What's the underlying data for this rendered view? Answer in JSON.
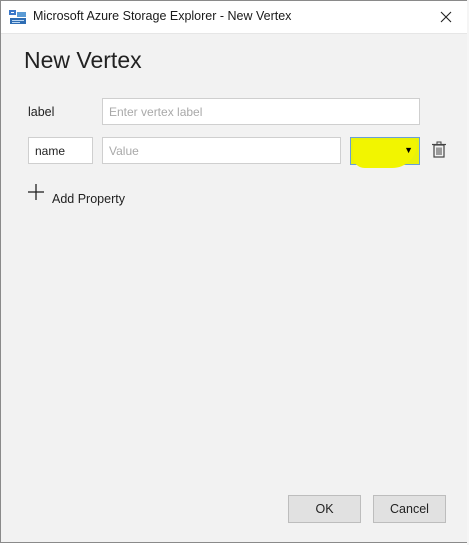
{
  "window": {
    "title": "Microsoft Azure Storage Explorer - New Vertex",
    "icon": "azure-storage-explorer-icon",
    "close_icon": "close-icon"
  },
  "dialog": {
    "heading": "New Vertex",
    "label_row": {
      "label": "label",
      "placeholder": "Enter vertex label",
      "value": ""
    },
    "property_row": {
      "name_value": "name",
      "value_placeholder": "Value",
      "value": "",
      "type_select": {
        "selected": "",
        "arrow_icon": "dropdown-arrow-icon",
        "highlight_color": "#f2f500"
      },
      "delete_icon": "trash-icon"
    },
    "add_property": {
      "label": "Add Property",
      "icon": "plus-icon"
    },
    "buttons": {
      "ok": "OK",
      "cancel": "Cancel"
    }
  }
}
